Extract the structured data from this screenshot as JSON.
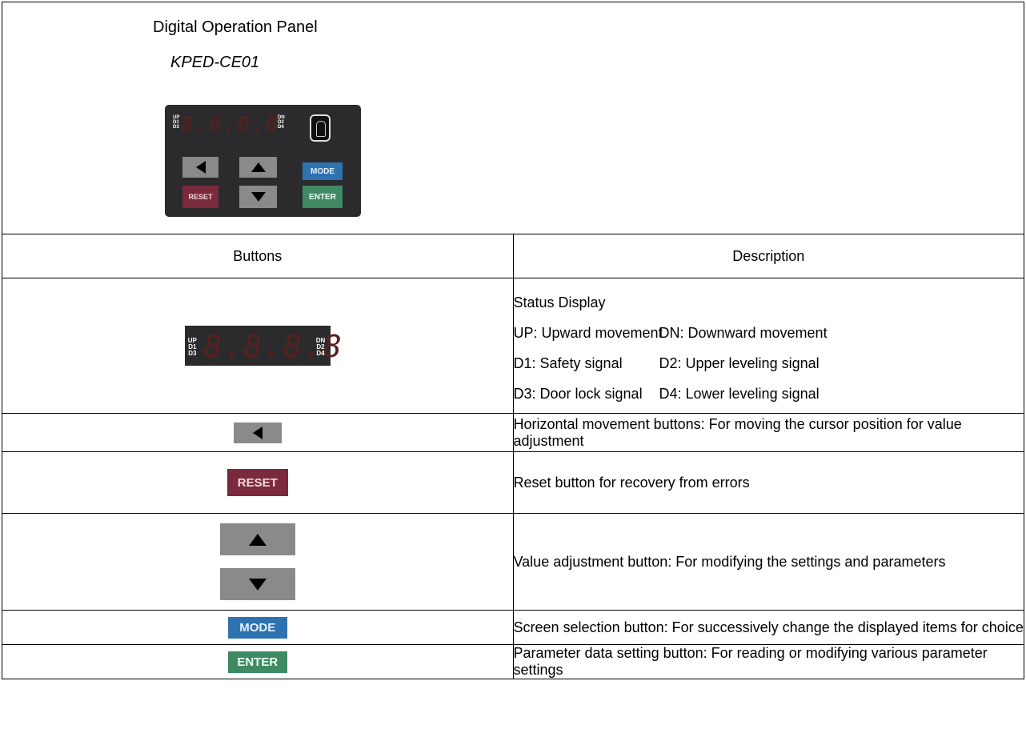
{
  "header": {
    "title": "Digital Operation Panel",
    "model": "KPED-CE01"
  },
  "keypad": {
    "indicators_left": [
      "UP",
      "D1",
      "D3"
    ],
    "indicators_right": [
      "DN",
      "D2",
      "D4"
    ],
    "digits": "8.8.8.8",
    "keys": {
      "mode": "MODE",
      "reset": "RESET",
      "enter": "ENTER"
    }
  },
  "table": {
    "col_buttons": "Buttons",
    "col_description": "Description",
    "status": {
      "title": "Status Display",
      "pairs": [
        [
          "UP: Upward movement",
          "DN: Downward movement"
        ],
        [
          "D1: Safety signal",
          "D2: Upper leveling signal"
        ],
        [
          "D3: Door lock signal",
          "D4: Lower leveling signal"
        ]
      ]
    },
    "rows": {
      "horizontal": "Horizontal movement buttons: For moving the cursor position for value adjustment",
      "reset": "Reset button for recovery from errors",
      "value": "Value adjustment button: For modifying the settings and parameters",
      "mode": "Screen selection button: For successively change the displayed items for choice",
      "enter": "Parameter data setting button: For reading or modifying various parameter settings"
    }
  },
  "colors": {
    "panel": "#2b2b2d",
    "grey_key": "#8a8a8a",
    "reset_key": "#7a2a3c",
    "mode_key": "#2e72b0",
    "enter_key": "#3f8a63",
    "digit_red": "#5a2020"
  }
}
